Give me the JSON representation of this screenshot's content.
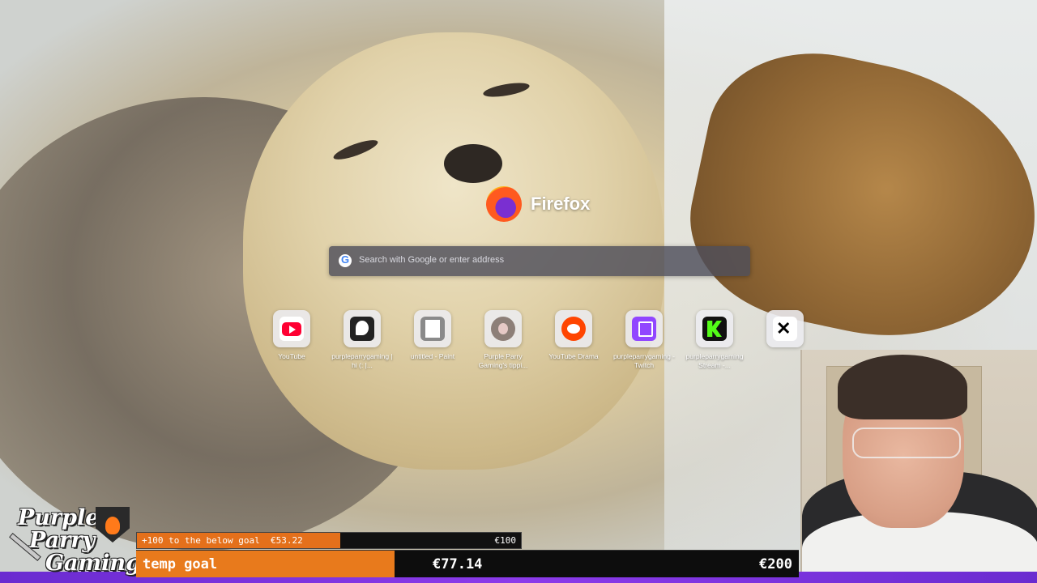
{
  "browser": {
    "brand": "Firefox",
    "search_placeholder": "Search with Google or enter address",
    "search_engine_glyph": "G"
  },
  "shortcuts": [
    {
      "label": "YouTube",
      "icon": "youtube-icon",
      "color": "#ff0033"
    },
    {
      "label": "purpleparrygaming | hi (: |...",
      "icon": "picsart-icon",
      "color": "#222222"
    },
    {
      "label": "untitled - Paint",
      "icon": "paint-icon",
      "color": "#6b6b6b"
    },
    {
      "label": "Purple Parry Gaming's tippi...",
      "icon": "avatar-icon",
      "color": "#7a6d6a"
    },
    {
      "label": "YouTube Drama",
      "icon": "reddit-icon",
      "color": "#ff4500"
    },
    {
      "label": "purpleparrygaming - Twitch",
      "icon": "twitch-icon",
      "color": "#9146ff"
    },
    {
      "label": "purpleparrygaming Stream -...",
      "icon": "kick-icon",
      "color": "#53fc18"
    },
    {
      "label": "",
      "icon": "x-icon",
      "color": "#000000"
    }
  ],
  "channel_logo": {
    "line1": "Purple",
    "line2": "Parry",
    "line3": "Gaming"
  },
  "goal_small": {
    "text": "+100 to the below goal",
    "amount": "€53.22",
    "target": "€100",
    "progress": 0.53,
    "color": "#e4701b"
  },
  "goal_main": {
    "name": "temp goal",
    "current": "€77.14",
    "target": "€200",
    "progress": 0.39,
    "color": "#e87a1c"
  }
}
